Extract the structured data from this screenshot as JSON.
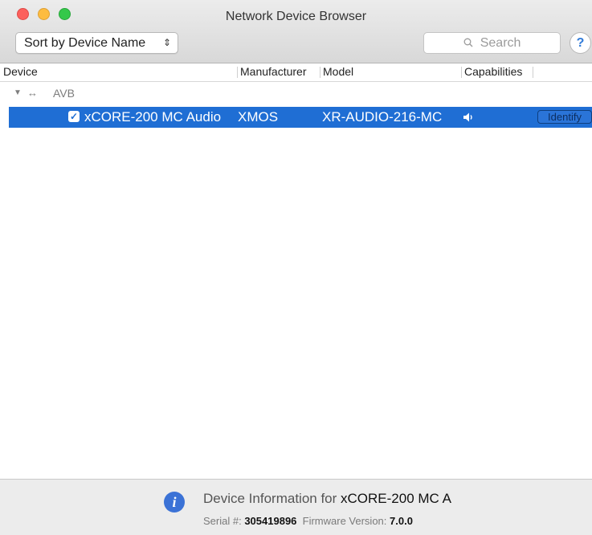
{
  "window": {
    "title": "Network Device Browser"
  },
  "toolbar": {
    "sort_label": "Sort by Device Name",
    "search_placeholder": "Search",
    "help_label": "?"
  },
  "columns": {
    "device": "Device",
    "manufacturer": "Manufacturer",
    "model": "Model",
    "capabilities": "Capabilities"
  },
  "group": {
    "label": "AVB",
    "expanded": true
  },
  "devices": [
    {
      "checked": true,
      "name": "xCORE-200 MC Audio",
      "manufacturer": "XMOS",
      "model": "XR-AUDIO-216-MC",
      "capability_icon": "speaker-icon",
      "identify_label": "Identify",
      "selected": true
    }
  ],
  "info_panel": {
    "title_prefix": "Device Information for",
    "device_name": "xCORE-200 MC A",
    "serial_label": "Serial #:",
    "serial_value": "305419896",
    "firmware_label": "Firmware Version:",
    "firmware_value": "7.0.0"
  },
  "colors": {
    "selection": "#1f6ed4",
    "info_icon": "#3b72d6",
    "close": "#fc605c",
    "minimize": "#fdbc40",
    "zoom": "#34c84a"
  }
}
